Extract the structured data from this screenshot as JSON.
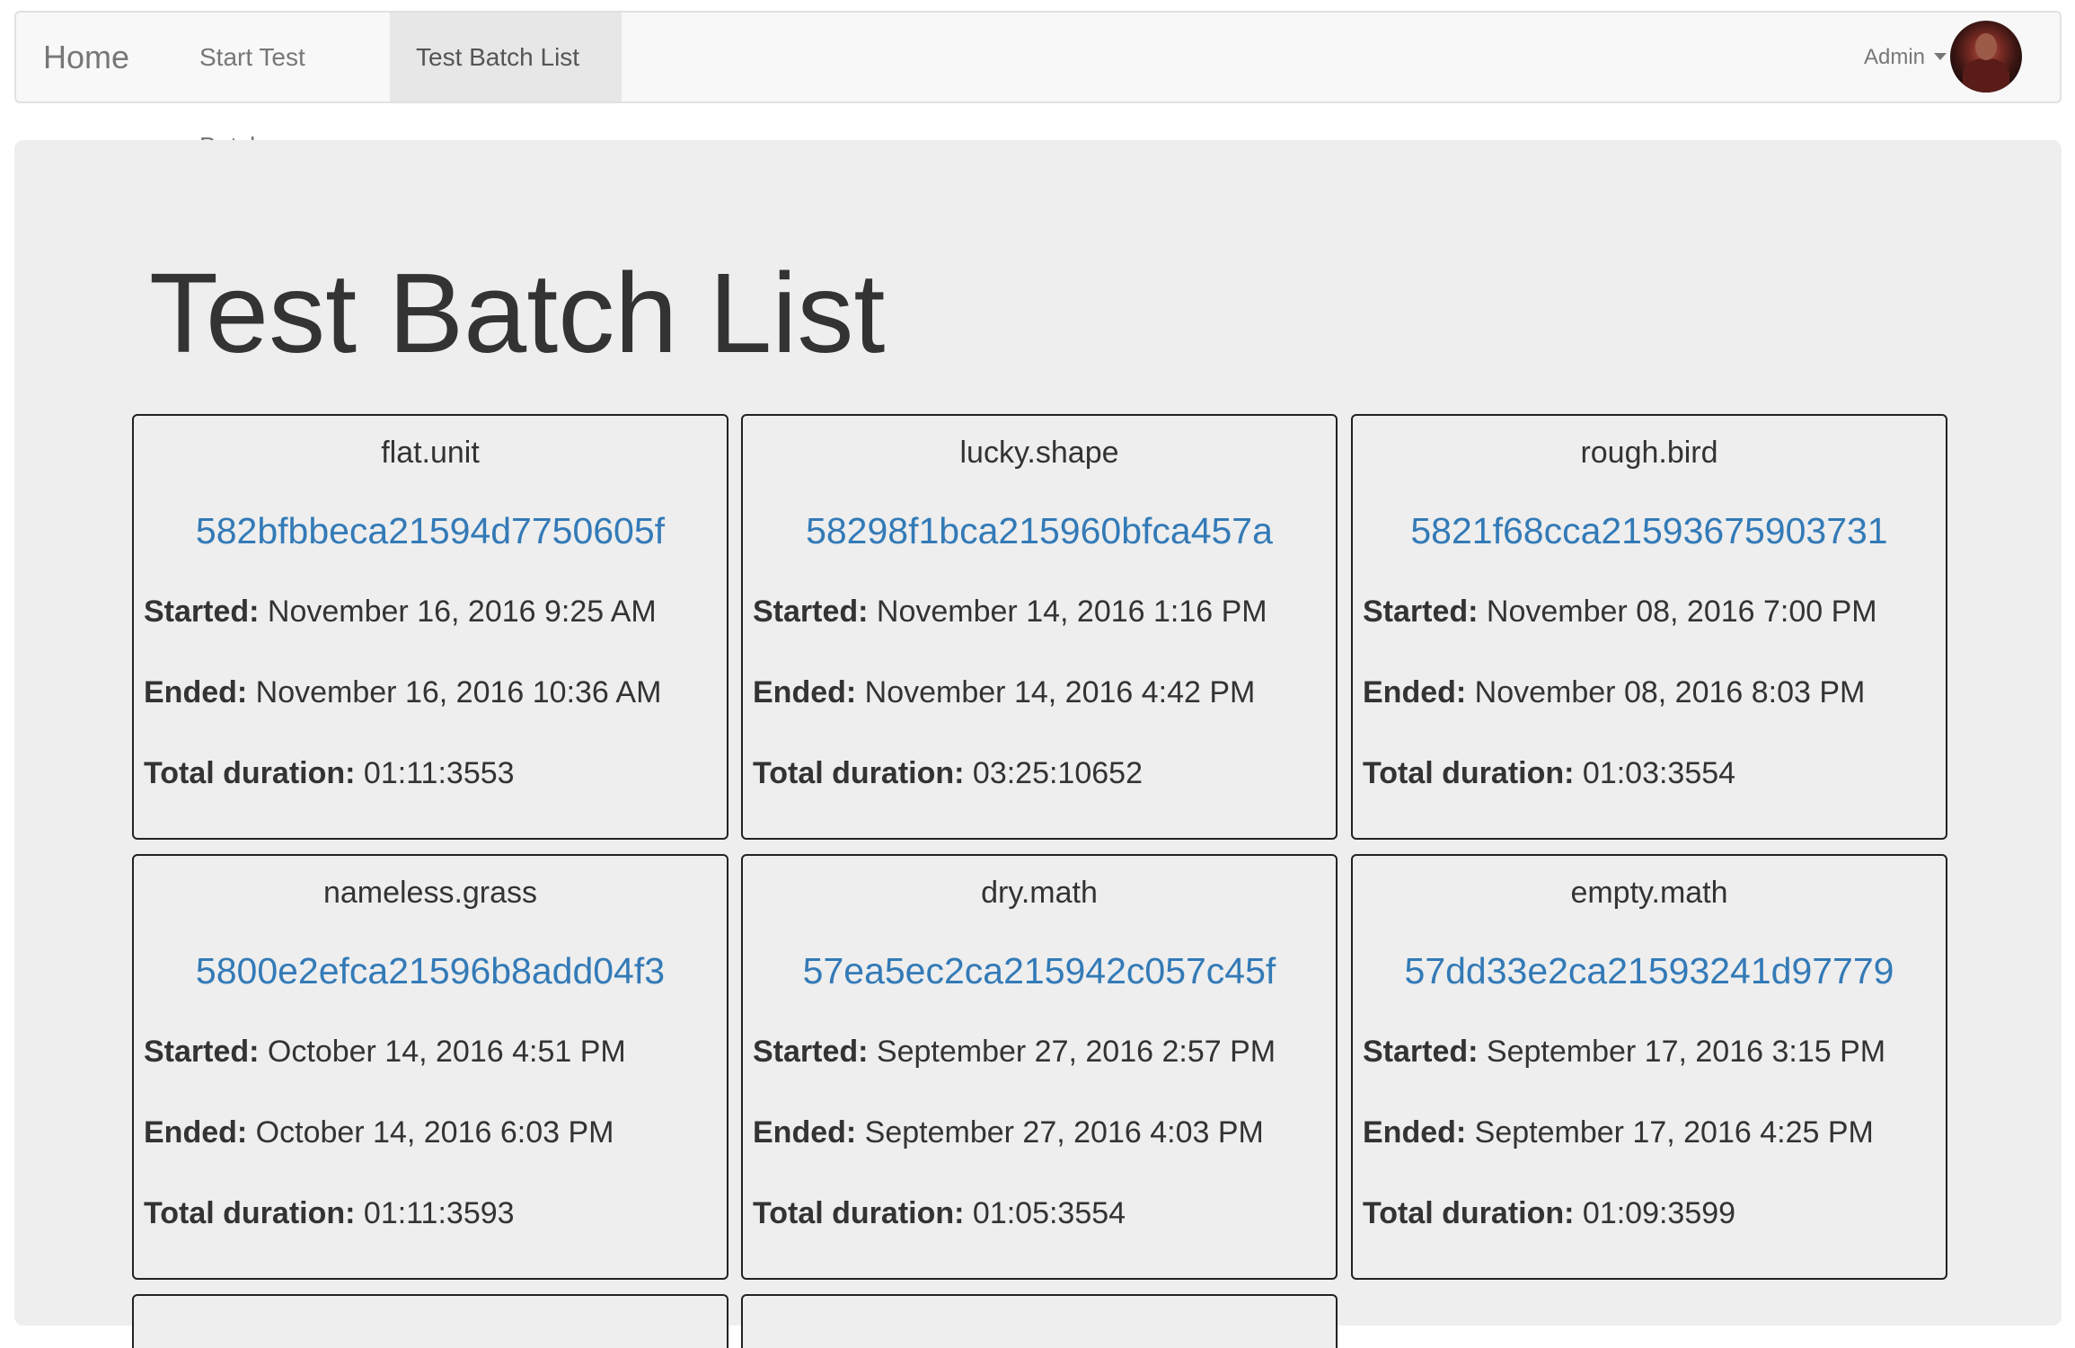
{
  "navbar": {
    "brand": "Home",
    "items": [
      {
        "label": "Start Test Batch"
      },
      {
        "label": "Test Batch List"
      }
    ],
    "user": {
      "label": "Admin"
    }
  },
  "page": {
    "title": "Test Batch List"
  },
  "labels": {
    "started": "Started:",
    "ended": "Ended:",
    "duration": "Total duration:"
  },
  "batches": [
    {
      "name": "flat.unit",
      "id": "582bfbbeca21594d7750605f",
      "started": "November 16, 2016 9:25 AM",
      "ended": "November 16, 2016 10:36 AM",
      "duration": "01:11:3553"
    },
    {
      "name": "lucky.shape",
      "id": "58298f1bca215960bfca457a",
      "started": "November 14, 2016 1:16 PM",
      "ended": "November 14, 2016 4:42 PM",
      "duration": "03:25:10652"
    },
    {
      "name": "rough.bird",
      "id": "5821f68cca21593675903731",
      "started": "November 08, 2016 7:00 PM",
      "ended": "November 08, 2016 8:03 PM",
      "duration": "01:03:3554"
    },
    {
      "name": "nameless.grass",
      "id": "5800e2efca21596b8add04f3",
      "started": "October 14, 2016 4:51 PM",
      "ended": "October 14, 2016 6:03 PM",
      "duration": "01:11:3593"
    },
    {
      "name": "dry.math",
      "id": "57ea5ec2ca215942c057c45f",
      "started": "September 27, 2016 2:57 PM",
      "ended": "September 27, 2016 4:03 PM",
      "duration": "01:05:3554"
    },
    {
      "name": "empty.math",
      "id": "57dd33e2ca21593241d97779",
      "started": "September 17, 2016 3:15 PM",
      "ended": "September 17, 2016 4:25 PM",
      "duration": "01:09:3599"
    }
  ],
  "colors": {
    "link": "#337ab7",
    "jumbotron_bg": "#eeeeee",
    "navbar_bg": "#f8f8f8"
  }
}
